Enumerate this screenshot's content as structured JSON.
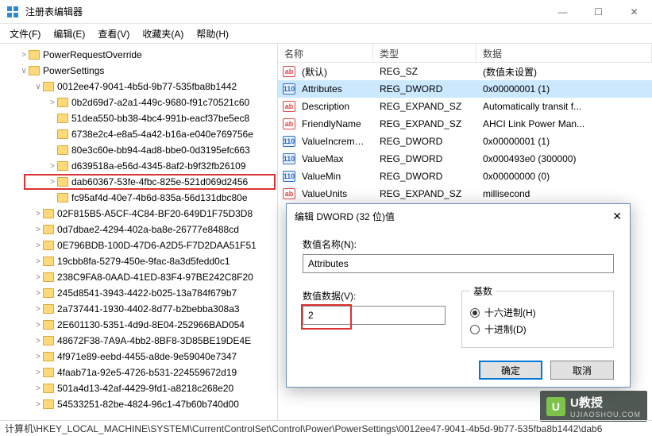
{
  "window": {
    "title": "注册表编辑器",
    "buttons": {
      "min": "—",
      "max": "☐",
      "close": "✕"
    }
  },
  "menu": [
    "文件(F)",
    "编辑(E)",
    "查看(V)",
    "收藏夹(A)",
    "帮助(H)"
  ],
  "tree": {
    "items": [
      {
        "indent": 1,
        "exp": ">",
        "label": "PowerRequestOverride"
      },
      {
        "indent": 1,
        "exp": "∨",
        "label": "PowerSettings"
      },
      {
        "indent": 2,
        "exp": "∨",
        "label": "0012ee47-9041-4b5d-9b77-535fba8b1442"
      },
      {
        "indent": 3,
        "exp": ">",
        "label": "0b2d69d7-a2a1-449c-9680-f91c70521c60"
      },
      {
        "indent": 3,
        "exp": "",
        "label": "51dea550-bb38-4bc4-991b-eacf37be5ec8"
      },
      {
        "indent": 3,
        "exp": "",
        "label": "6738e2c4-e8a5-4a42-b16a-e040e769756e"
      },
      {
        "indent": 3,
        "exp": "",
        "label": "80e3c60e-bb94-4ad8-bbe0-0d3195efc663"
      },
      {
        "indent": 3,
        "exp": ">",
        "label": "d639518a-e56d-4345-8af2-b9f32fb26109"
      },
      {
        "indent": 3,
        "exp": ">",
        "label": "dab60367-53fe-4fbc-825e-521d069d2456",
        "hl": true
      },
      {
        "indent": 3,
        "exp": "",
        "label": "fc95af4d-40e7-4b6d-835a-56d131dbc80e"
      },
      {
        "indent": 2,
        "exp": ">",
        "label": "02F815B5-A5CF-4C84-BF20-649D1F75D3D8"
      },
      {
        "indent": 2,
        "exp": ">",
        "label": "0d7dbae2-4294-402a-ba8e-26777e8488cd"
      },
      {
        "indent": 2,
        "exp": ">",
        "label": "0E796BDB-100D-47D6-A2D5-F7D2DAA51F51"
      },
      {
        "indent": 2,
        "exp": ">",
        "label": "19cbb8fa-5279-450e-9fac-8a3d5fedd0c1"
      },
      {
        "indent": 2,
        "exp": ">",
        "label": "238C9FA8-0AAD-41ED-83F4-97BE242C8F20"
      },
      {
        "indent": 2,
        "exp": ">",
        "label": "245d8541-3943-4422-b025-13a784f679b7"
      },
      {
        "indent": 2,
        "exp": ">",
        "label": "2a737441-1930-4402-8d77-b2bebba308a3"
      },
      {
        "indent": 2,
        "exp": ">",
        "label": "2E601130-5351-4d9d-8E04-252966BAD054"
      },
      {
        "indent": 2,
        "exp": ">",
        "label": "48672F38-7A9A-4bb2-8BF8-3D85BE19DE4E"
      },
      {
        "indent": 2,
        "exp": ">",
        "label": "4f971e89-eebd-4455-a8de-9e59040e7347"
      },
      {
        "indent": 2,
        "exp": ">",
        "label": "4faab71a-92e5-4726-b531-224559672d19"
      },
      {
        "indent": 2,
        "exp": ">",
        "label": "501a4d13-42af-4429-9fd1-a8218c268e20"
      },
      {
        "indent": 2,
        "exp": ">",
        "label": "54533251-82be-4824-96c1-47b60b740d00"
      }
    ]
  },
  "list": {
    "headers": {
      "name": "名称",
      "type": "类型",
      "data": "数据"
    },
    "rows": [
      {
        "icon": "sz",
        "name": "(默认)",
        "type": "REG_SZ",
        "data": "(数值未设置)"
      },
      {
        "icon": "dw",
        "name": "Attributes",
        "type": "REG_DWORD",
        "data": "0x00000001 (1)",
        "selected": true
      },
      {
        "icon": "sz",
        "name": "Description",
        "type": "REG_EXPAND_SZ",
        "data": "Automatically transit f..."
      },
      {
        "icon": "sz",
        "name": "FriendlyName",
        "type": "REG_EXPAND_SZ",
        "data": "AHCI Link Power Man..."
      },
      {
        "icon": "dw",
        "name": "ValueIncrement",
        "type": "REG_DWORD",
        "data": "0x00000001 (1)"
      },
      {
        "icon": "dw",
        "name": "ValueMax",
        "type": "REG_DWORD",
        "data": "0x000493e0 (300000)"
      },
      {
        "icon": "dw",
        "name": "ValueMin",
        "type": "REG_DWORD",
        "data": "0x00000000 (0)"
      },
      {
        "icon": "sz",
        "name": "ValueUnits",
        "type": "REG_EXPAND_SZ",
        "data": "millisecond"
      }
    ]
  },
  "dialog": {
    "title": "编辑 DWORD (32 位)值",
    "name_label": "数值名称(N):",
    "name_value": "Attributes",
    "data_label": "数值数据(V):",
    "data_value": "2",
    "base_label": "基数",
    "radio_hex": "十六进制(H)",
    "radio_dec": "十进制(D)",
    "ok": "确定",
    "cancel": "取消"
  },
  "statusbar": "计算机\\HKEY_LOCAL_MACHINE\\SYSTEM\\CurrentControlSet\\Control\\Power\\PowerSettings\\0012ee47-9041-4b5d-9b77-535fba8b1442\\dab6",
  "watermark": {
    "brand": "U教授",
    "url": "UJIAOSHOU.COM"
  }
}
